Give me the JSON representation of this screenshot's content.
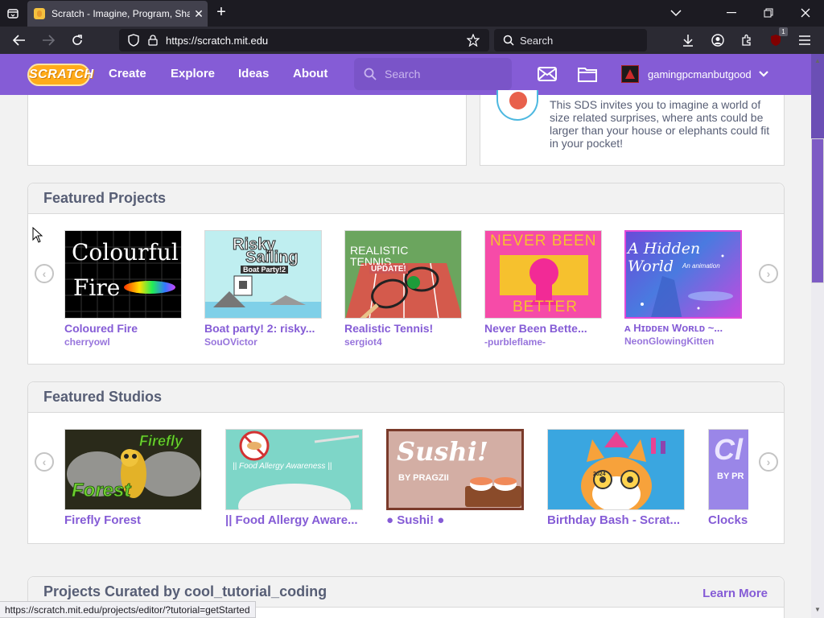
{
  "browser": {
    "tab_title": "Scratch - Imagine, Program, Sha",
    "url_host": "https://scratch.mit.edu",
    "search_placeholder": "Search",
    "extension_badge": "1",
    "status_url": "https://scratch.mit.edu/projects/editor/?tutorial=getStarted"
  },
  "header": {
    "logo_text": "SCRATCH",
    "nav": [
      "Create",
      "Explore",
      "Ideas",
      "About"
    ],
    "search_placeholder": "Search",
    "username": "gamingpcmanbutgood"
  },
  "sds_card": {
    "text": "This SDS invites you to imagine a world of size related surprises, where ants could be larger than your house or elephants could fit in your pocket!"
  },
  "featured_projects": {
    "title": "Featured Projects",
    "items": [
      {
        "title": "Coloured Fire",
        "author": "cherryowl",
        "thumb_text_1": "Colourful",
        "thumb_text_2": "Fire"
      },
      {
        "title": "Boat party! 2: risky...",
        "author": "SouOVictor",
        "thumb_text_1": "Risky",
        "thumb_text_2": "Sailing",
        "thumb_text_3": "Boat Party!2"
      },
      {
        "title": "Realistic Tennis!",
        "author": "sergiot4",
        "thumb_text_1": "REALISTIC",
        "thumb_text_2": "TENNIS",
        "thumb_text_3": "UPDATE!"
      },
      {
        "title": "Never Been Bette...",
        "author": "-purbleflame-",
        "thumb_text_1": "NEVER BEEN",
        "thumb_text_2": "BETTER"
      },
      {
        "title": "ᴀ Hɪᴅᴅᴇɴ Wᴏʀʟᴅ ~...",
        "author": "NeonGlowingKitten",
        "thumb_text_1": "A Hidden World",
        "thumb_text_2": "An animation"
      }
    ]
  },
  "featured_studios": {
    "title": "Featured Studios",
    "items": [
      {
        "title": "Firefly Forest",
        "thumb_text_1": "Firefly",
        "thumb_text_2": "Forest"
      },
      {
        "title": "|| Food Allergy Aware...",
        "thumb_text_1": "|| Food Allergy Awareness ||"
      },
      {
        "title": "● Sushi! ●",
        "thumb_text_1": "Sushi!",
        "thumb_text_2": "BY PRAGZII"
      },
      {
        "title": "Birthday Bash - Scrat...",
        "thumb_text_1": "2024"
      },
      {
        "title": "Clocks!",
        "thumb_text_1": "Cl",
        "thumb_text_2": "BY PR"
      }
    ]
  },
  "curated": {
    "title": "Projects Curated by cool_tutorial_coding",
    "learn_more": "Learn More"
  },
  "colors": {
    "scratch_purple": "#855cd6",
    "text_gray": "#575e75",
    "chrome_dark": "#1c1b22"
  },
  "icons": [
    "list-all-tabs-icon",
    "back-icon",
    "forward-icon",
    "reload-icon",
    "shield-icon",
    "lock-icon",
    "bookmark-star-icon",
    "search-icon",
    "download-icon",
    "account-icon",
    "extensions-icon",
    "ublock-icon",
    "menu-icon",
    "messages-icon",
    "my-stuff-folder-icon",
    "chevron-down-icon",
    "arrow-left-icon",
    "arrow-right-icon"
  ]
}
